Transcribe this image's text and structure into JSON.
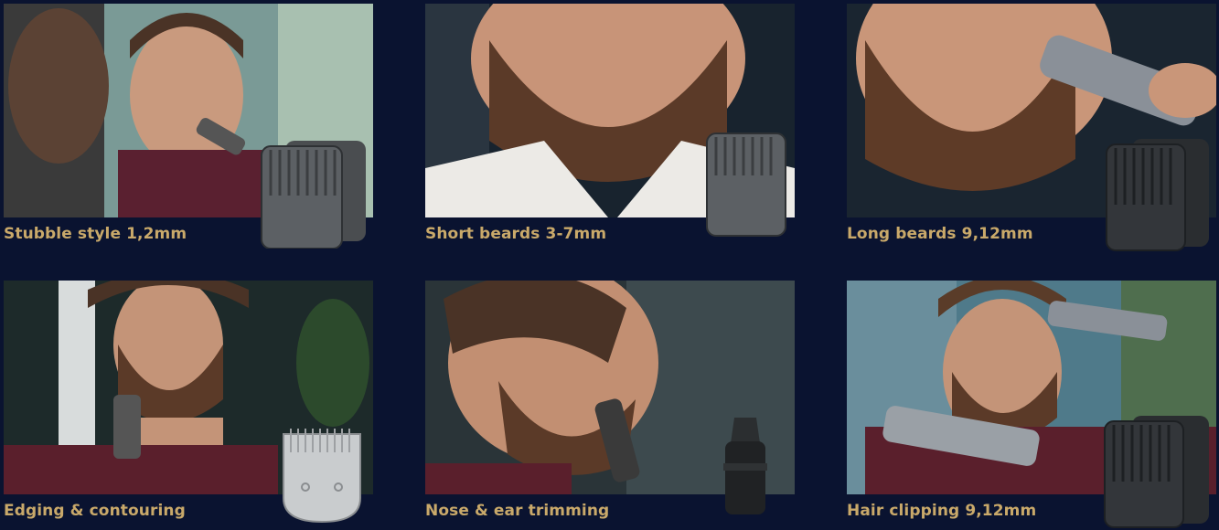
{
  "tiles": [
    {
      "caption": "Stubble style 1,2mm",
      "accessory": "twin-comb-icon",
      "bg": "#6a8a8a"
    },
    {
      "caption": "Short beards 3-7mm",
      "accessory": "beard-comb-icon",
      "bg": "#18232e"
    },
    {
      "caption": "Long beards 9,12mm",
      "accessory": "long-comb-icon",
      "bg": "#1a2530"
    },
    {
      "caption": "Edging & contouring",
      "accessory": "precision-trimmer-head-icon",
      "bg": "#1d2a2a"
    },
    {
      "caption": "Nose & ear trimming",
      "accessory": "nose-trimmer-head-icon",
      "bg": "#2a3438"
    },
    {
      "caption": "Hair clipping 9,12mm",
      "accessory": "hair-comb-icon",
      "bg": "#4f7a8a"
    }
  ],
  "colors": {
    "background": "#0a1330",
    "caption": "#c9a96a"
  }
}
